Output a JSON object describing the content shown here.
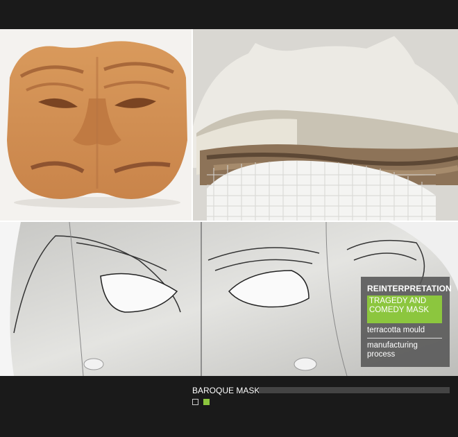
{
  "gallery": {
    "title": "BAROQUE MASK",
    "pages": [
      "page 1",
      "page 2"
    ],
    "active_page": 2
  },
  "panel": {
    "header": "REINTERPRETATION",
    "active_item": "TRAGEDY AND COMEDY MASK",
    "items": [
      "terracotta mould",
      "manufacturing process"
    ]
  },
  "colors": {
    "accent": "#8cc63e",
    "background": "#1a1a1a",
    "panel": "#555555"
  }
}
